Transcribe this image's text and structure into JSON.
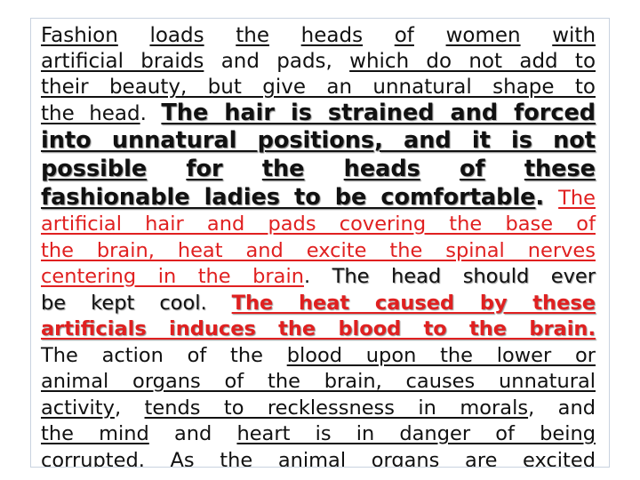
{
  "lines": [
    [
      "Fashion",
      "loads",
      "the",
      "heads",
      "of",
      "women",
      "with"
    ],
    [
      "artificial braids",
      "and pads,",
      "which do not add to"
    ],
    [
      "their beauty, but give an unnatural shape to"
    ],
    [
      "the head",
      ".",
      "The hair is strained and forced"
    ],
    [
      "into unnatural positions, and it is not"
    ],
    [
      "possible",
      "for",
      "the",
      "heads",
      "of",
      "these"
    ],
    [
      "fashionable ladies to be comfortable",
      ".",
      "The"
    ],
    [
      "artificial hair and pads covering the base of"
    ],
    [
      "the brain, heat and excite the spinal nerves"
    ],
    [
      "centering in the brain",
      ".",
      "The head should ever"
    ],
    [
      "be kept cool.",
      "The heat caused by these"
    ],
    [
      "artificials induces the blood to the brain."
    ],
    [
      "The action of the",
      "blood upon the lower or"
    ],
    [
      "animal organs of the brain, causes unnatural"
    ],
    [
      "activity",
      ",",
      "tends to recklessness in morals",
      ",",
      "and"
    ],
    [
      "the mind",
      "and",
      "heart is in danger of being"
    ],
    [
      "corrupted",
      ".",
      "As the animal organs are excited"
    ]
  ]
}
